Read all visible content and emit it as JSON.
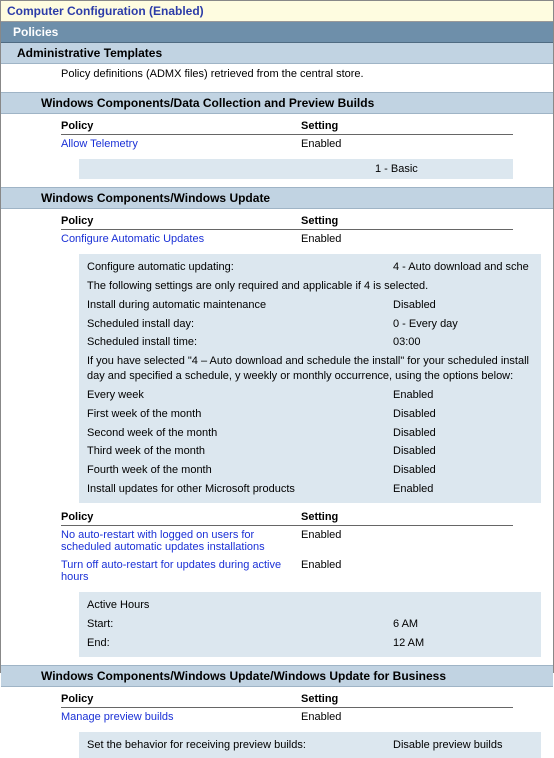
{
  "header": {
    "title": "Computer Configuration (Enabled)",
    "policies": "Policies",
    "adminTemplates": "Administrative Templates",
    "policyDef": "Policy definitions (ADMX files) retrieved from the central store."
  },
  "columns": {
    "policy": "Policy",
    "setting": "Setting"
  },
  "sections": [
    {
      "title": "Windows Components/Data Collection and Preview Builds",
      "policies": [
        {
          "name": "Allow Telemetry",
          "setting": "Enabled"
        }
      ],
      "subBand": [
        {
          "label": "",
          "value": "1 - Basic"
        }
      ]
    },
    {
      "title": "Windows Components/Windows Update",
      "policies": [
        {
          "name": "Configure Automatic Updates",
          "setting": "Enabled"
        }
      ],
      "details": [
        {
          "label": "Configure automatic updating:",
          "value": "4 - Auto download and sche"
        },
        {
          "full": "The following settings are only required and applicable if 4 is selected."
        },
        {
          "label": "Install during automatic maintenance",
          "value": "Disabled"
        },
        {
          "label": "Scheduled install day:",
          "value": "0 - Every day"
        },
        {
          "label": "Scheduled install time:",
          "value": "03:00"
        },
        {
          "full": "If you have selected \"4 – Auto download and schedule the install\" for your scheduled install day and specified a schedule, y weekly or monthly occurrence, using the options below:"
        },
        {
          "label": "Every week",
          "value": "Enabled"
        },
        {
          "label": "First week of the month",
          "value": "Disabled"
        },
        {
          "label": "Second week of the month",
          "value": "Disabled"
        },
        {
          "label": "Third week of the month",
          "value": "Disabled"
        },
        {
          "label": "Fourth week of the month",
          "value": "Disabled"
        },
        {
          "label": "Install updates for other Microsoft products",
          "value": "Enabled"
        }
      ],
      "policies2": [
        {
          "name": "No auto-restart with logged on users for scheduled automatic updates installations",
          "setting": "Enabled"
        },
        {
          "name": "Turn off auto-restart for updates during active hours",
          "setting": "Enabled"
        }
      ],
      "details2": [
        {
          "full": "Active Hours"
        },
        {
          "label": "Start:",
          "value": "6 AM"
        },
        {
          "label": "End:",
          "value": "12 AM"
        }
      ]
    },
    {
      "title": "Windows Components/Windows Update/Windows Update for Business",
      "policies": [
        {
          "name": "Manage preview builds",
          "setting": "Enabled"
        }
      ],
      "details": [
        {
          "label": "Set the behavior for receiving preview builds:",
          "value": "Disable preview builds"
        }
      ]
    }
  ]
}
